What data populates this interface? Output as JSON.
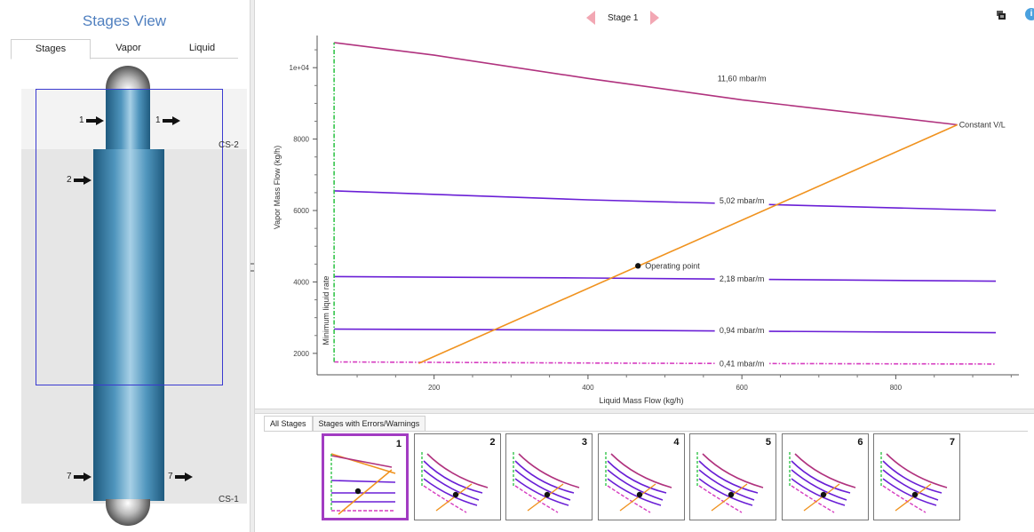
{
  "left_panel": {
    "title": "Stages View",
    "tabs": [
      {
        "label": "Stages",
        "active": true
      },
      {
        "label": "Vapor",
        "active": false
      },
      {
        "label": "Liquid",
        "active": false
      }
    ],
    "sections": [
      {
        "label": "CS-2"
      },
      {
        "label": "CS-1"
      }
    ],
    "streams": [
      {
        "label": "1",
        "side": "left"
      },
      {
        "label": "1",
        "side": "right"
      },
      {
        "label": "2",
        "side": "left"
      },
      {
        "label": "7",
        "side": "left"
      },
      {
        "label": "7",
        "side": "right"
      }
    ]
  },
  "header": {
    "stage_label": "Stage 1"
  },
  "chart_data": {
    "type": "line",
    "xlabel": "Liquid Mass Flow (kg/h)",
    "ylabel": "Vapor Mass Flow (kg/h)",
    "xlim": [
      48,
      960
    ],
    "ylim": [
      1400,
      10900
    ],
    "xticks": [
      200,
      400,
      600,
      800
    ],
    "yticks": [
      2000,
      4000,
      6000,
      8000,
      10000
    ],
    "ytick_labels": [
      "2000",
      "4000",
      "6000",
      "8000",
      "1e+04"
    ],
    "grid": false,
    "series": [
      {
        "name": "11,60 mbar/m",
        "color": "#b0327e",
        "style": "solid",
        "points": [
          [
            70,
            10700
          ],
          [
            200,
            10350
          ],
          [
            400,
            9700
          ],
          [
            600,
            9100
          ],
          [
            880,
            8400
          ]
        ],
        "label_at": [
          600,
          9700
        ]
      },
      {
        "name": "5,02 mbar/m",
        "color": "#6a1fd6",
        "style": "solid",
        "points": [
          [
            70,
            6550
          ],
          [
            400,
            6300
          ],
          [
            700,
            6130
          ],
          [
            930,
            6000
          ]
        ],
        "label_at": [
          600,
          6270
        ]
      },
      {
        "name": "2,18 mbar/m",
        "color": "#6a1fd6",
        "style": "solid",
        "points": [
          [
            70,
            4150
          ],
          [
            400,
            4110
          ],
          [
            930,
            4020
          ]
        ],
        "label_at": [
          600,
          4090
        ]
      },
      {
        "name": "0,94 mbar/m",
        "color": "#6a1fd6",
        "style": "solid",
        "points": [
          [
            70,
            2680
          ],
          [
            400,
            2650
          ],
          [
            930,
            2580
          ]
        ],
        "label_at": [
          600,
          2640
        ]
      },
      {
        "name": "0,41 mbar/m",
        "color": "#d63cc0",
        "style": "dashdot",
        "points": [
          [
            70,
            1760
          ],
          [
            500,
            1720
          ],
          [
            930,
            1700
          ]
        ],
        "label_at": [
          600,
          1710
        ]
      },
      {
        "name": "Constant V/L",
        "color": "#f0921e",
        "style": "solid",
        "points": [
          [
            180,
            1720
          ],
          [
            880,
            8400
          ]
        ],
        "label_at": [
          880,
          8400
        ]
      },
      {
        "name": "Minimum liquid rate",
        "color": "#33c44a",
        "style": "dashdot",
        "points": [
          [
            70,
            1760
          ],
          [
            70,
            10700
          ]
        ],
        "label_at": [
          60,
          3200
        ]
      }
    ],
    "annotations": [
      {
        "text": "Operating point",
        "x": 465,
        "y": 4450,
        "marker": "dot"
      }
    ]
  },
  "bottom_panel": {
    "tabs": [
      {
        "label": "All Stages",
        "active": true
      },
      {
        "label": "Stages with Errors/Warnings",
        "active": false
      }
    ],
    "thumbnails": [
      {
        "number": "1",
        "selected": true
      },
      {
        "number": "2",
        "selected": false
      },
      {
        "number": "3",
        "selected": false
      },
      {
        "number": "4",
        "selected": false
      },
      {
        "number": "5",
        "selected": false
      },
      {
        "number": "6",
        "selected": false
      },
      {
        "number": "7",
        "selected": false
      }
    ]
  },
  "colors": {
    "accent": "#4f7fbf",
    "selection": "#a23cc2",
    "nav_arrow": "#f2a7b3",
    "info": "#4aa1df"
  }
}
